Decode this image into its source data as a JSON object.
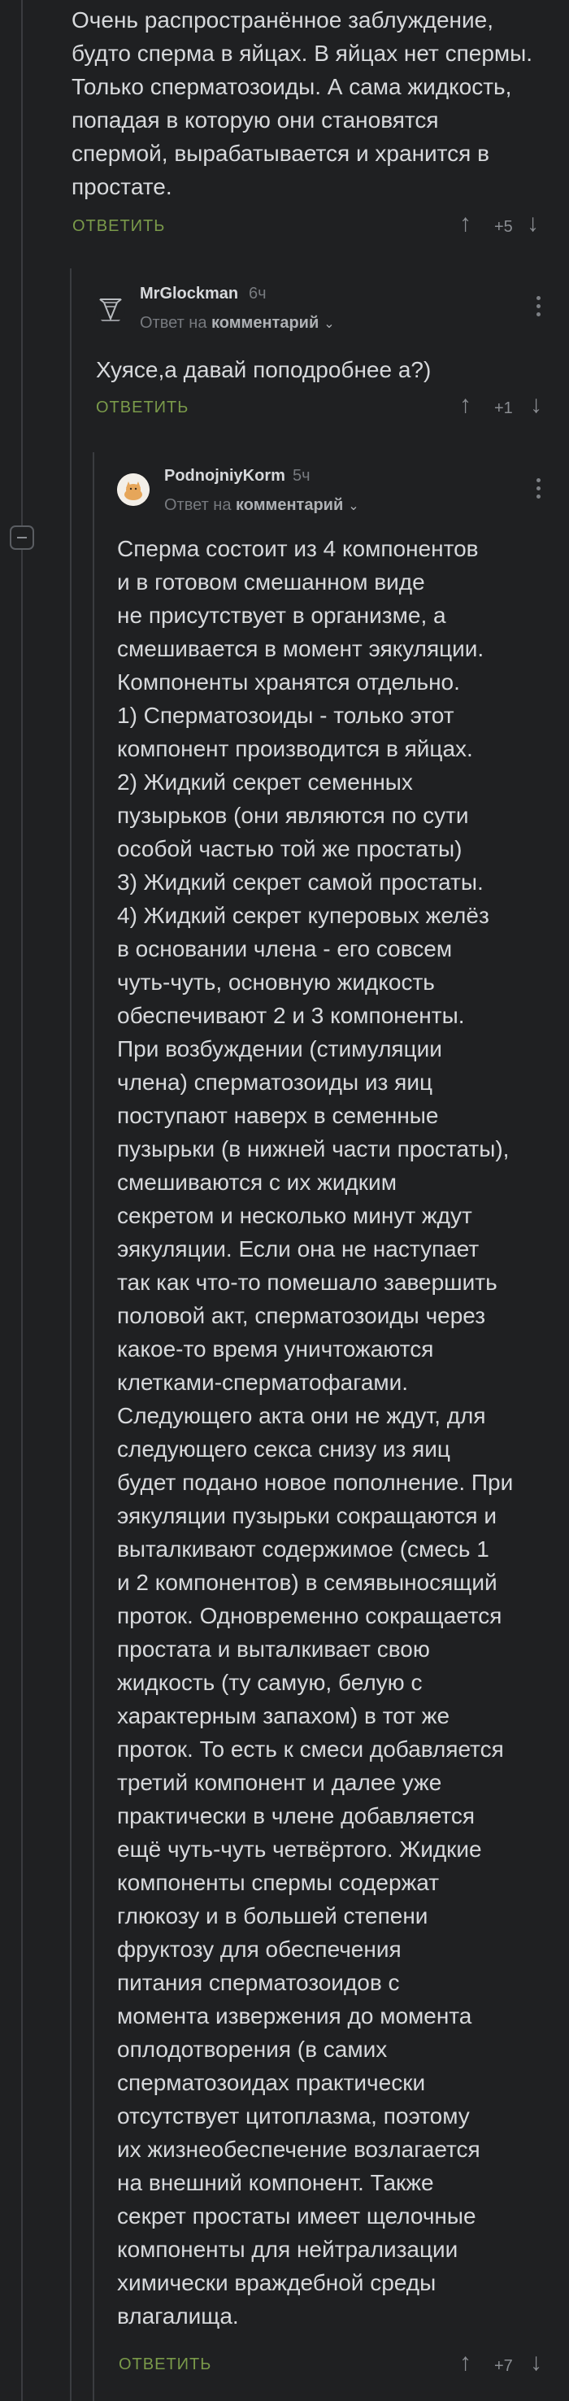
{
  "comment1": {
    "text": "Очень распространённое заблуждение,\nбудто сперма в яйцах. В яйцах нет спермы.\nТолько сперматозоиды. А сама жидкость,\nпопадая в которую они становятся\nспермой, вырабатывается и хранится в\nпростате.",
    "reply_label": "ОТВЕТИТЬ",
    "rating": "+5"
  },
  "comment2": {
    "username": "MrGlockman",
    "time": "6ч",
    "reply_to_prefix": "Ответ на",
    "reply_to_target": "комментарий",
    "text": "Хуясе,а давай поподробнее а?)",
    "reply_label": "ОТВЕТИТЬ",
    "rating": "+1"
  },
  "comment3": {
    "username": "PodnojniyKorm",
    "time": "5ч",
    "reply_to_prefix": "Ответ на",
    "reply_to_target": "комментарий",
    "text": "Сперма состоит из 4 компонентов\nи в готовом смешанном виде\nне присутствует в организме, а\nсмешивается в момент эякуляции.\nКомпоненты хранятся отдельно.\n1) Сперматозоиды - только этот\nкомпонент производится в яйцах.\n2) Жидкий секрет семенных\nпузырьков (они являются по сути\nособой частью той же простаты)\n3) Жидкий секрет самой простаты.\n4) Жидкий секрет куперовых желёз\nв основании члена - его совсем\nчуть-чуть, основную жидкость\nобеспечивают 2 и 3 компоненты.\nПри возбуждении (стимуляции\nчлена) сперматозоиды из яиц\nпоступают наверх в семенные\nпузырьки (в нижней части простаты),\nсмешиваются с их жидким\nсекретом и несколько минут ждут\nэякуляции. Если она не наступает\nтак как что-то помешало завершить\nполовой акт, сперматозоиды через\nкакое-то время уничтожаются\nклетками-сперматофагами.\nСледующего акта они не ждут, для\nследующего секса снизу из яиц\nбудет подано новое пополнение. При\nэякуляции пузырьки сокращаются и\nвыталкивают содержимое (смесь 1\nи 2 компонентов) в семявыносящий\nпроток. Одновременно сокращается\nпростата и выталкивает свою\nжидкость (ту самую, белую с\nхарактерным запахом) в тот же\nпроток. То есть к смеси добавляется\nтретий компонент и далее уже\nпрактически в члене добавляется\nещё чуть-чуть четвёртого. Жидкие\nкомпоненты спермы содержат\nглюкозу и в большей степени\nфруктозу для обеспечения\nпитания сперматозоидов с\nмомента извержения до момента\nоплодотворения (в самих\nсперматозоидах практически\nотсутствует цитоплазма, поэтому\nих жизнеобеспечение возлагается\nна внешний компонент. Также\nсекрет простаты имеет щелочные\nкомпоненты для нейтрализации\nхимически враждебной среды\nвлагалища.",
    "reply_label": "ОТВЕТИТЬ",
    "rating": "+7"
  },
  "icons": {
    "upvote": "arrow-up",
    "downvote": "arrow-down",
    "collapse": "minus-square",
    "more": "three-dots-vertical"
  },
  "colors": {
    "background": "#1f2022",
    "text": "#d7d9dc",
    "reply_link": "#7a9a4a",
    "muted": "#8a8d92"
  }
}
